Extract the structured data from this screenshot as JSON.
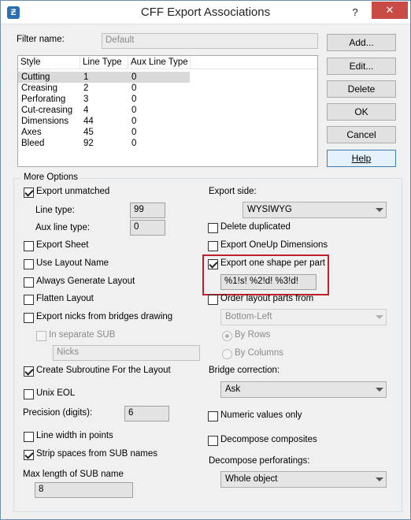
{
  "window": {
    "title": "CFF Export Associations",
    "help_glyph": "?",
    "close_glyph": "✕",
    "icon_glyph": "Ƶ"
  },
  "filter": {
    "label": "Filter name:",
    "value": "Default"
  },
  "list": {
    "headers": [
      "Style",
      "Line Type",
      "Aux Line Type"
    ],
    "rows": [
      {
        "style": "Cutting",
        "line_type": "1",
        "aux": "0"
      },
      {
        "style": "Creasing",
        "line_type": "2",
        "aux": "0"
      },
      {
        "style": "Perforating",
        "line_type": "3",
        "aux": "0"
      },
      {
        "style": "Cut-creasing",
        "line_type": "4",
        "aux": "0"
      },
      {
        "style": "Dimensions",
        "line_type": "44",
        "aux": "0"
      },
      {
        "style": "Axes",
        "line_type": "45",
        "aux": "0"
      },
      {
        "style": "Bleed",
        "line_type": "92",
        "aux": "0"
      }
    ],
    "selected_index": 0
  },
  "buttons": {
    "add": "Add...",
    "edit": "Edit...",
    "delete": "Delete",
    "ok": "OK",
    "cancel": "Cancel",
    "help": "Help"
  },
  "more_options": {
    "title": "More Options",
    "export_unmatched": {
      "label": "Export unmatched",
      "checked": true
    },
    "line_type": {
      "label": "Line type:",
      "value": "99"
    },
    "aux_line_type": {
      "label": "Aux line type:",
      "value": "0"
    },
    "export_sheet": {
      "label": "Export Sheet",
      "checked": false
    },
    "use_layout_name": {
      "label": "Use Layout Name",
      "checked": false
    },
    "always_generate_layout": {
      "label": "Always Generate Layout",
      "checked": false
    },
    "flatten_layout": {
      "label": "Flatten Layout",
      "checked": false
    },
    "export_nicks": {
      "label": "Export nicks from bridges drawing",
      "checked": false
    },
    "in_separate_sub": {
      "label": "In separate SUB",
      "checked": false
    },
    "nicks_field": {
      "value": "Nicks"
    },
    "create_subroutine": {
      "label": "Create Subroutine For the Layout",
      "checked": true
    },
    "unix_eol": {
      "label": "Unix EOL",
      "checked": false
    },
    "precision": {
      "label": "Precision (digits):",
      "value": "6"
    },
    "line_width_points": {
      "label": "Line width in points",
      "checked": false
    },
    "strip_spaces": {
      "label": "Strip spaces from SUB names",
      "checked": true
    },
    "max_sub_name": {
      "label": "Max length of SUB name",
      "value": "8"
    },
    "export_side": {
      "label": "Export side:",
      "value": "WYSIWYG"
    },
    "delete_duplicated": {
      "label": "Delete duplicated",
      "checked": false
    },
    "export_oneup": {
      "label": "Export OneUp Dimensions",
      "checked": false
    },
    "export_one_shape": {
      "label": "Export one shape per part",
      "checked": true
    },
    "shape_pattern": {
      "value": "%1!s! %2!d! %3!d!"
    },
    "order_layout": {
      "label": "Order layout parts from",
      "checked": false
    },
    "order_combo": {
      "value": "Bottom-Left"
    },
    "by_rows": {
      "label": "By Rows",
      "checked": true
    },
    "by_columns": {
      "label": "By Columns",
      "checked": false
    },
    "bridge_correction": {
      "label": "Bridge correction:",
      "value": "Ask"
    },
    "numeric_only": {
      "label": "Numeric values only",
      "checked": false
    },
    "decompose_composites": {
      "label": "Decompose composites",
      "checked": false
    },
    "decompose_perforatings": {
      "label": "Decompose perforatings:",
      "value": "Whole object"
    }
  },
  "colors": {
    "highlight": "#c0202a",
    "close_button": "#c94b46",
    "accent": "#3c7fb1"
  }
}
